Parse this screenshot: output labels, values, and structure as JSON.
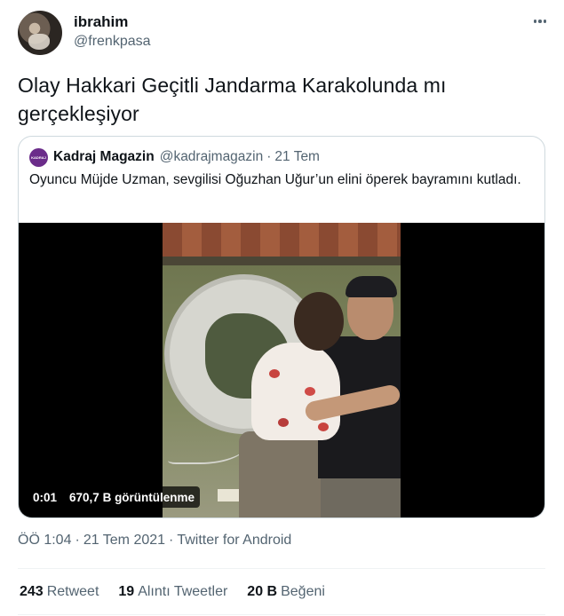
{
  "author": {
    "name": "ibrahim",
    "handle": "@frenkpasa"
  },
  "tweet": {
    "text": "Olay Hakkari Geçitli Jandarma Karakolunda mı gerçekleşiyor"
  },
  "quoted_tweet": {
    "name": "Kadraj Magazin",
    "handle": "@kadrajmagazin",
    "separator": "·",
    "date": "21 Tem",
    "text": "Oyuncu Müjde Uzman, sevgilisi Oğuzhan Uğur’un elini öperek bayramını kutladı.",
    "video": {
      "time": "0:01",
      "views": "670,7 B görüntülenme"
    }
  },
  "meta": {
    "time": "ÖÖ 1:04",
    "date": "21 Tem 2021",
    "source": "Twitter for Android",
    "separator": "·"
  },
  "stats": [
    {
      "count": "243",
      "label": "Retweet"
    },
    {
      "count": "19",
      "label": "Alıntı Tweetler"
    },
    {
      "count": "20 B",
      "label": "Beğeni"
    }
  ],
  "icons": {
    "more": "more-horizontal-icon"
  },
  "colors": {
    "text_primary": "#0f1419",
    "text_secondary": "#536471",
    "border": "#cfd9de",
    "quoted_avatar": "#6b2c8a"
  }
}
